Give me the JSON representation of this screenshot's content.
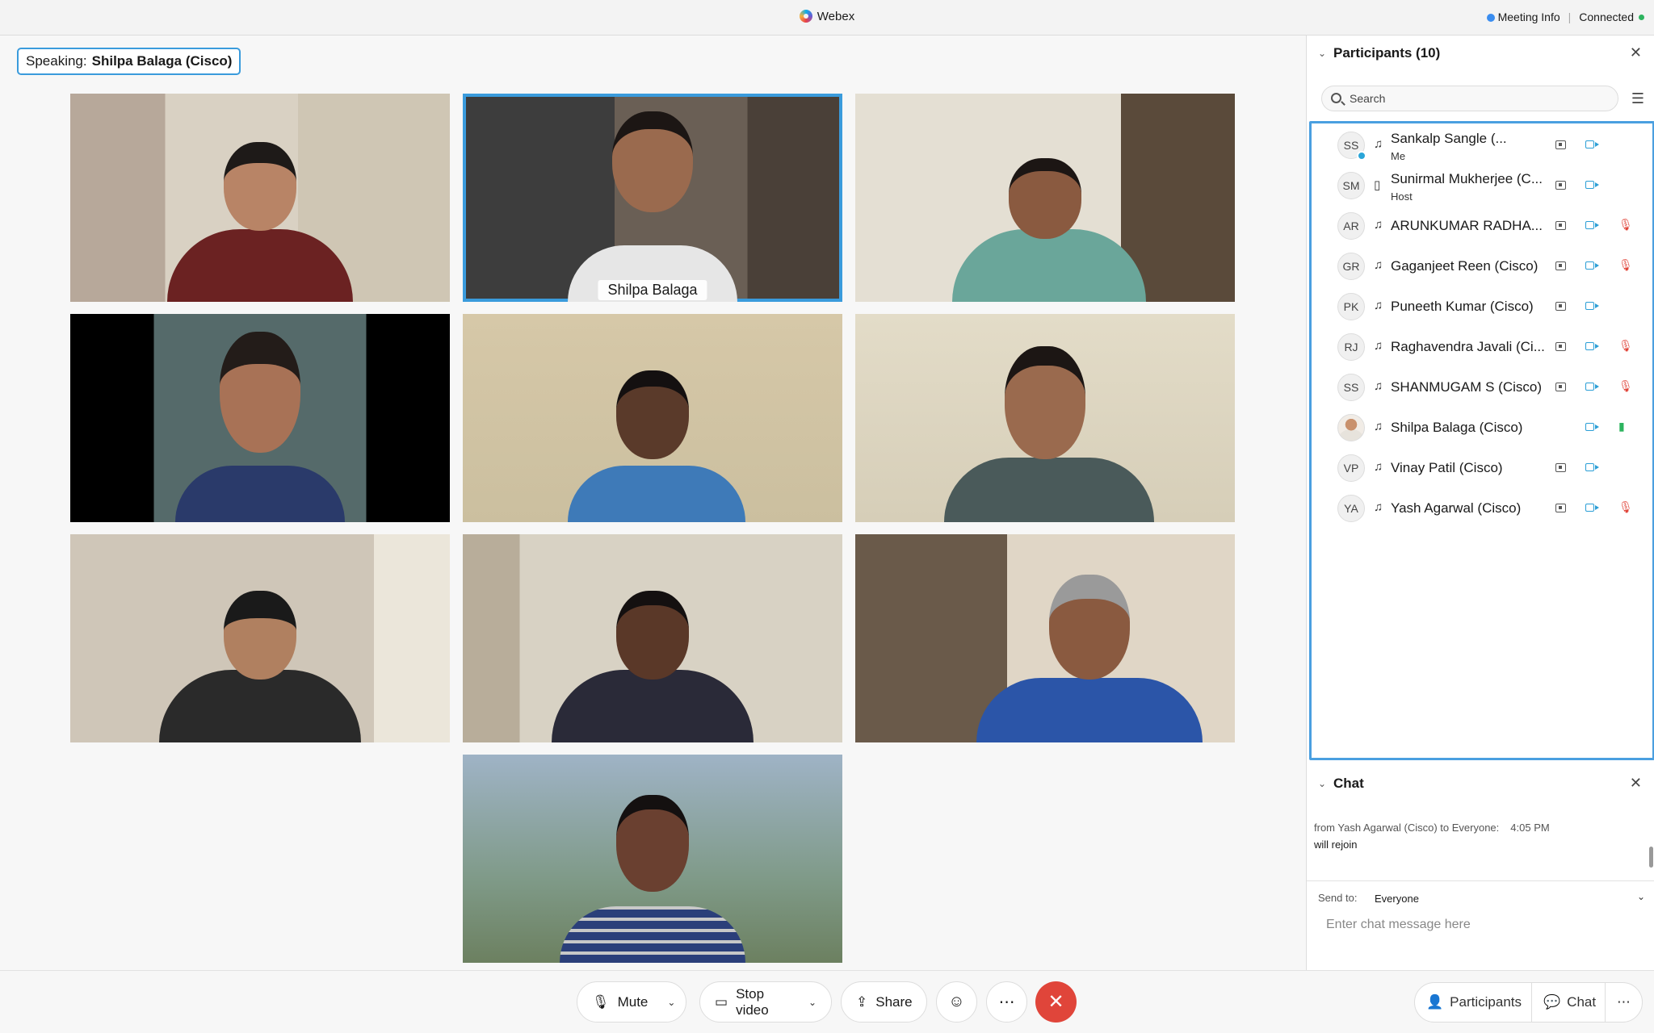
{
  "titlebar": {
    "app_name": "Webex",
    "meeting_info": "Meeting Info",
    "separator": "|",
    "connection": "Connected"
  },
  "stage": {
    "speaking_label": "Speaking:",
    "speaking_name": "Shilpa Balaga (Cisco)",
    "active_tile_name": "Shilpa Balaga"
  },
  "toolbar": {
    "mute": "Mute",
    "stop_video": "Stop video",
    "share": "Share",
    "reactions_icon": "smiley-icon",
    "more_icon": "ellipsis-icon",
    "end_icon": "close-icon"
  },
  "participants_panel": {
    "title": "Participants (10)",
    "search_placeholder": "Search",
    "list": [
      {
        "initials": "SS",
        "name": "Sankalp Sangle (...",
        "role": "Me",
        "device": "headset",
        "mic": "none"
      },
      {
        "initials": "SM",
        "name": "Sunirmal Mukherjee (C...",
        "role": "Host",
        "device": "phone",
        "mic": "none"
      },
      {
        "initials": "AR",
        "name": "ARUNKUMAR RADHA...",
        "role": "",
        "device": "headset",
        "mic": "muted"
      },
      {
        "initials": "GR",
        "name": "Gaganjeet Reen (Cisco)",
        "role": "",
        "device": "headset",
        "mic": "muted"
      },
      {
        "initials": "PK",
        "name": "Puneeth Kumar (Cisco)",
        "role": "",
        "device": "headset",
        "mic": "none"
      },
      {
        "initials": "RJ",
        "name": "Raghavendra Javali (Ci...",
        "role": "",
        "device": "headset",
        "mic": "muted"
      },
      {
        "initials": "SS",
        "name": "SHANMUGAM S (Cisco)",
        "role": "",
        "device": "headset",
        "mic": "muted"
      },
      {
        "initials": "",
        "name": "Shilpa Balaga (Cisco)",
        "role": "",
        "device": "headset",
        "mic": "on"
      },
      {
        "initials": "VP",
        "name": "Vinay Patil (Cisco)",
        "role": "",
        "device": "headset",
        "mic": "none"
      },
      {
        "initials": "YA",
        "name": "Yash Agarwal (Cisco)",
        "role": "",
        "device": "headset",
        "mic": "muted"
      }
    ]
  },
  "chat_panel": {
    "title": "Chat",
    "message_meta": "from Yash Agarwal (Cisco) to Everyone:",
    "message_time": "4:05  PM",
    "message_text": "will rejoin",
    "send_to_label": "Send to:",
    "send_to_value": "Everyone",
    "input_placeholder": "Enter chat message here"
  },
  "bottom_right": {
    "participants": "Participants",
    "chat": "Chat"
  },
  "colors": {
    "accent": "#3a9bdc",
    "end_call": "#e0453a",
    "connected": "#2cb35e",
    "muted": "#e0453a"
  }
}
